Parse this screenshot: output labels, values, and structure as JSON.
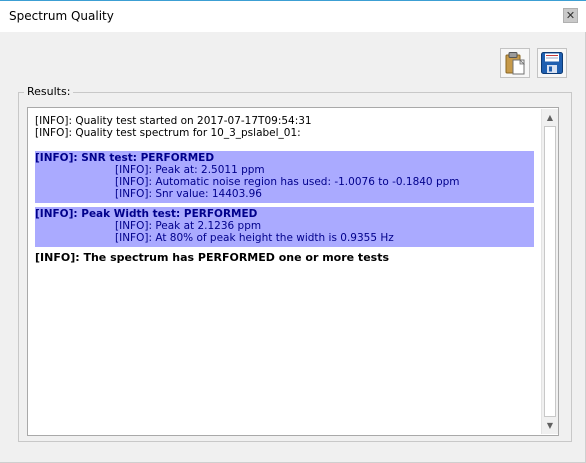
{
  "window": {
    "title": "Spectrum Quality",
    "close_glyph": "✕"
  },
  "toolbar": {
    "paste_icon": "clipboard-icon",
    "save_icon": "floppy-disk-icon"
  },
  "results": {
    "label": "Results:",
    "intro_lines": [
      "[INFO]: Quality test started on 2017-07-17T09:54:31",
      "[INFO]: Quality test spectrum for 10_3_pslabel_01:"
    ],
    "blocks": [
      {
        "heading": "[INFO]: SNR test: PERFORMED",
        "details": [
          "[INFO]: Peak at: 2.5011 ppm",
          "[INFO]: Automatic noise region has used: -1.0076 to -0.1840 ppm",
          "[INFO]: Snr value: 14403.96"
        ]
      },
      {
        "heading": "[INFO]: Peak Width test: PERFORMED",
        "details": [
          "[INFO]: Peak at 2.1236 ppm",
          "[INFO]: At 80% of peak height the width is 0.9355 Hz"
        ]
      }
    ],
    "summary": "[INFO]: The spectrum has PERFORMED one or more tests"
  },
  "colors": {
    "highlight": "#aaaaff",
    "highlight_text": "#00008b",
    "title_accent": "#3c9fd3"
  }
}
